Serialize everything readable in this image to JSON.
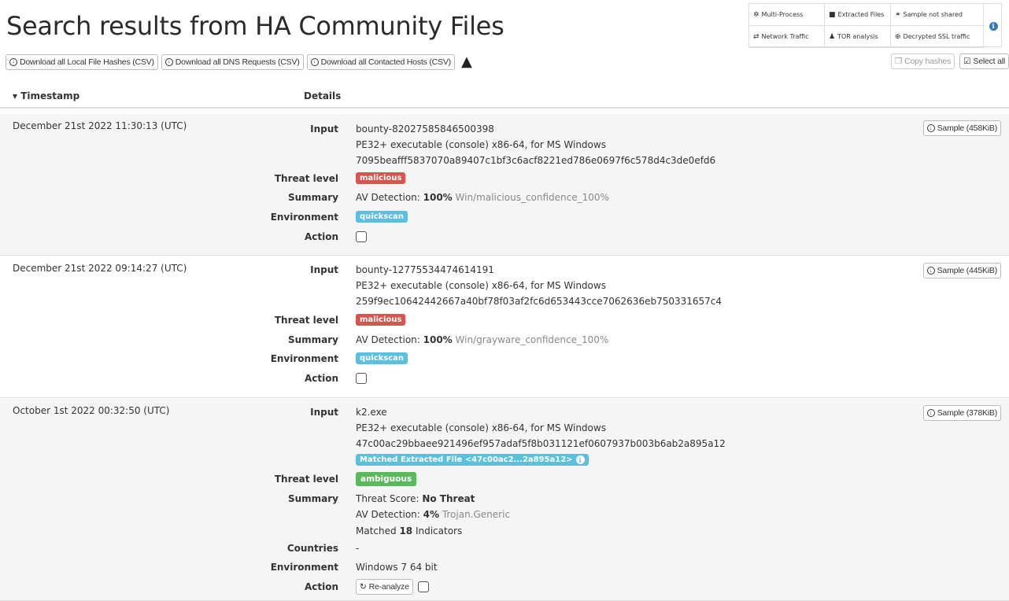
{
  "page": {
    "title": "Search results from HA Community Files"
  },
  "legend": {
    "items": [
      {
        "icon": "✲",
        "label": "Multi-Process"
      },
      {
        "icon": "■",
        "label": "Extracted Files"
      },
      {
        "icon": "⚭",
        "label": "Sample not shared"
      },
      {
        "icon": "⇄",
        "label": "Network Traffic"
      },
      {
        "icon": "♟",
        "label": "TOR analysis"
      },
      {
        "icon": "⊕",
        "label": "Decrypted SSL traffic"
      }
    ],
    "info_icon": "i"
  },
  "toolbar": {
    "dl_hashes": "Download all Local File Hashes (CSV)",
    "dl_dns": "Download all DNS Requests (CSV)",
    "dl_hosts": "Download all Contacted Hosts (CSV)",
    "copy_hashes": "Copy hashes",
    "select_all": "Select all"
  },
  "table": {
    "col_timestamp": "▾ Timestamp",
    "col_details": "Details"
  },
  "labels": {
    "input": "Input",
    "threat_level": "Threat level",
    "summary": "Summary",
    "environment": "Environment",
    "action": "Action",
    "countries": "Countries"
  },
  "rows": [
    {
      "date": "December 21st 2022 11:30:13 (UTC)",
      "input_name": "bounty-82027585846500398",
      "file_type": "PE32+ executable (console) x86-64, for MS Windows",
      "hash": "7095beafff5837070a89407c1bf3c6acf8221ed786e0697f6c578d4c3de0efd6",
      "threat": "malicious",
      "av_prefix": "AV Detection: ",
      "av_pct": "100%",
      "av_name": " Win/malicious_confidence_100%",
      "environment": "quickscan",
      "sample": "Sample (458KiB)"
    },
    {
      "date": "December 21st 2022 09:14:27 (UTC)",
      "input_name": "bounty-12775534474614191",
      "file_type": "PE32+ executable (console) x86-64, for MS Windows",
      "hash": "259f9ec10642442667a40bf78f03af2fc6d653443cce7062636eb750331657c4",
      "threat": "malicious",
      "av_prefix": "AV Detection: ",
      "av_pct": "100%",
      "av_name": " Win/grayware_confidence_100%",
      "environment": "quickscan",
      "sample": "Sample (445KiB)"
    },
    {
      "date": "October 1st 2022 00:32:50 (UTC)",
      "input_name": "k2.exe",
      "file_type": "PE32+ executable (console) x86-64, for MS Windows",
      "hash": "47c00ac29bbaee921496ef957adaf5f8b031121ef0607937b003b6ab2a895a12",
      "matched": "Matched Extracted File <47c00ac2...2a895a12>",
      "threat": "ambiguous",
      "score_prefix": "Threat Score: ",
      "score_val": "No Threat",
      "av_prefix": "AV Detection: ",
      "av_pct": "4%",
      "av_name": " Trojan.Generic",
      "matched_prefix": "Matched ",
      "matched_count": "18",
      "matched_suffix": " Indicators",
      "countries": "-",
      "environment": "Windows 7 64 bit",
      "reanalyze": "Re-analyze",
      "sample": "Sample (378KiB)"
    }
  ]
}
